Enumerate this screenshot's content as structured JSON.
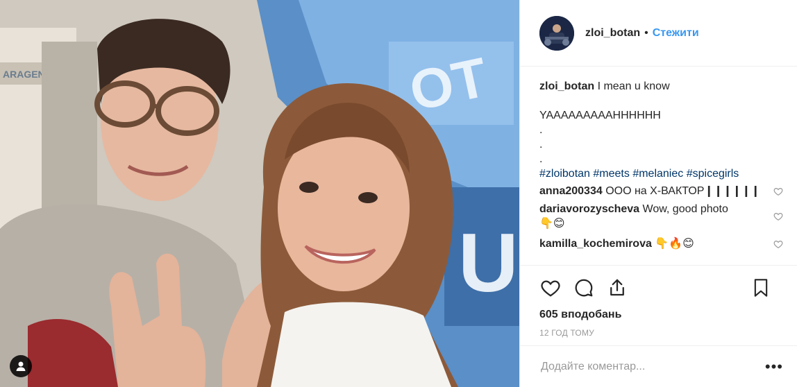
{
  "post": {
    "username": "zloi_botan",
    "separator": "•",
    "follow_label": "Стежити"
  },
  "caption": {
    "username": "zloi_botan",
    "line1": "I mean u know",
    "line2": "YAAAAAAAAAHHHHHH",
    "dots": [
      ".",
      ".",
      "."
    ],
    "hashtags": [
      "#zloibotan",
      "#meets",
      "#melaniec",
      "#spicegirls"
    ]
  },
  "comments": [
    {
      "username": "anna200334",
      "text": "ООО на Х-ВАКТОР❙❙❙❙❙❙"
    },
    {
      "username": "dariavorozyscheva",
      "text": "Wow, good photo",
      "text2": "👇😊"
    },
    {
      "username": "kamilla_kochemirova",
      "text": "👇🔥😊"
    }
  ],
  "likes": "605 вподобань",
  "timestamp": "12 ГОД ТОМУ",
  "add_comment": {
    "placeholder": "Додайте коментар..."
  },
  "more_label": "•••",
  "icons": [
    "heart-icon",
    "comment-icon",
    "share-icon",
    "bookmark-icon",
    "user-tag-icon"
  ],
  "colors": {
    "link": "#3897f0",
    "hashtag": "#003569",
    "muted": "#999999",
    "text": "#262626"
  }
}
